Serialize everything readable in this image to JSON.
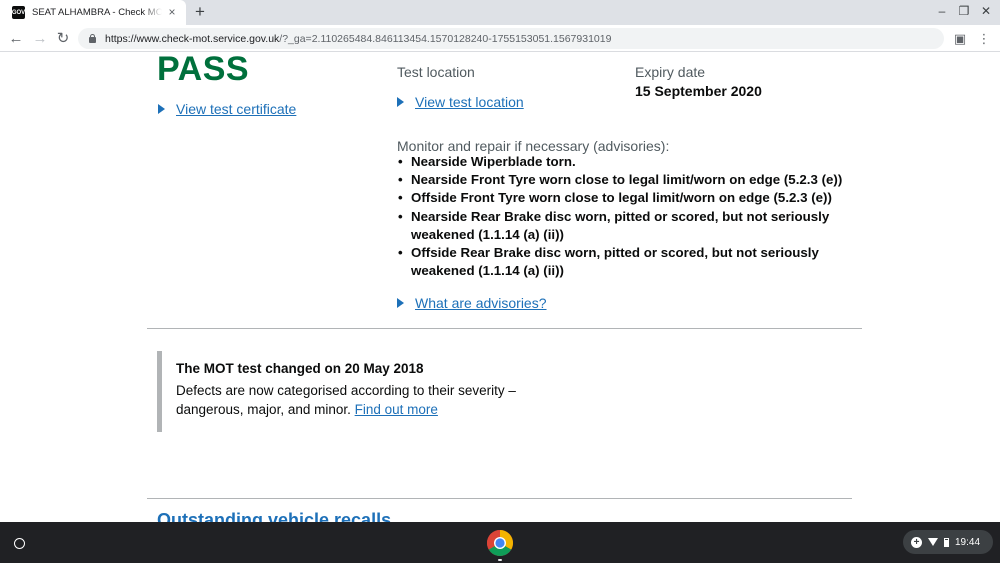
{
  "browser": {
    "tab_title": "SEAT ALHAMBRA - Check MOT history - GOV.UK",
    "tab_favicon_text": "GOV",
    "url_host": "https://www.check-mot.service.gov.uk",
    "url_path": "/?_ga=2.110265484.846113454.1570128240-1755153051.1567931019",
    "new_tab_glyph": "+",
    "close_glyph": "×"
  },
  "test": {
    "result": "PASS",
    "view_certificate_label": "View test certificate",
    "test_location_label": "Test location",
    "view_location_label": "View test location",
    "expiry_label": "Expiry date",
    "expiry_value": "15 September 2020",
    "advisories_label": "Monitor and repair if necessary (advisories):",
    "advisories": [
      "Nearside Wiperblade torn.",
      "Nearside Front Tyre worn close to legal limit/worn on edge (5.2.3 (e))",
      "Offside Front Tyre worn close to legal limit/worn on edge (5.2.3 (e))",
      "Nearside Rear Brake disc worn, pitted or scored, but not seriously weakened (1.1.14 (a) (ii))",
      "Offside Rear Brake disc worn, pitted or scored, but not seriously weakened (1.1.14 (a) (ii))"
    ],
    "what_are_advisories_label": "What are advisories?"
  },
  "notice": {
    "title": "The MOT test changed on 20 May 2018",
    "body": "Defects are now categorised according to their severity – dangerous, major, and minor.",
    "link_label": "Find out more"
  },
  "recalls": {
    "heading": "Outstanding vehicle recalls"
  },
  "shelf": {
    "time": "19:44"
  },
  "colors": {
    "pass_green": "#00703c",
    "link_blue": "#1d70b8",
    "border_grey": "#b1b4b6"
  }
}
